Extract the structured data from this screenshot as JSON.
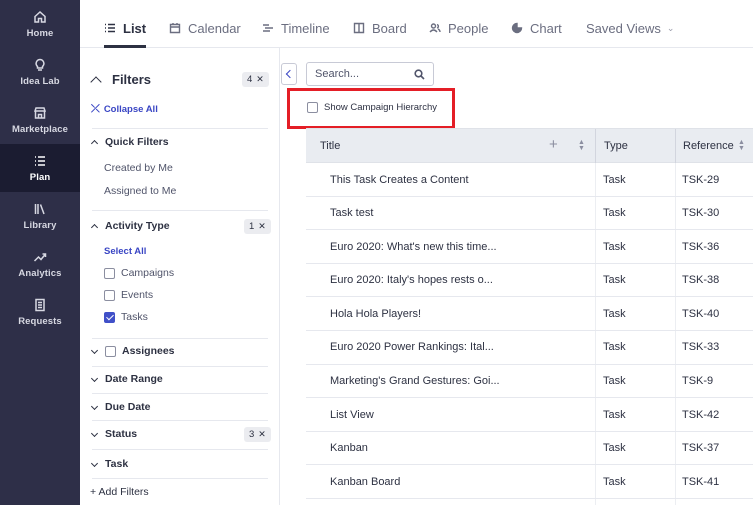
{
  "nav": {
    "items": [
      {
        "label": "Home",
        "icon": "home-icon"
      },
      {
        "label": "Idea Lab",
        "icon": "lightbulb-icon"
      },
      {
        "label": "Marketplace",
        "icon": "store-icon"
      },
      {
        "label": "Plan",
        "icon": "list-icon",
        "active": true
      },
      {
        "label": "Library",
        "icon": "library-icon"
      },
      {
        "label": "Analytics",
        "icon": "trend-icon"
      },
      {
        "label": "Requests",
        "icon": "document-icon"
      }
    ]
  },
  "tabs": {
    "list": "List",
    "calendar": "Calendar",
    "timeline": "Timeline",
    "board": "Board",
    "people": "People",
    "chart": "Chart",
    "saved_views": "Saved Views"
  },
  "filters": {
    "title": "Filters",
    "count": "4",
    "collapse_all": "Collapse All",
    "quick_filters": {
      "label": "Quick Filters",
      "options": [
        "Created by Me",
        "Assigned to Me"
      ]
    },
    "activity_type": {
      "label": "Activity Type",
      "count": "1",
      "select_all": "Select All",
      "options": [
        {
          "label": "Campaigns",
          "checked": false
        },
        {
          "label": "Events",
          "checked": false
        },
        {
          "label": "Tasks",
          "checked": true
        }
      ]
    },
    "assignees": "Assignees",
    "date_range": "Date Range",
    "due_date": "Due Date",
    "status": {
      "label": "Status",
      "count": "3"
    },
    "task": "Task",
    "add_filters": "+ Add Filters"
  },
  "search": {
    "placeholder": "Search..."
  },
  "hierarchy": {
    "label": "Show Campaign Hierarchy",
    "checked": false
  },
  "colors": {
    "nav_bg": "#2e2f48",
    "accent": "#3a46c4",
    "highlight": "#e41e26"
  },
  "table": {
    "columns": [
      "Title",
      "Type",
      "Reference"
    ],
    "rows": [
      {
        "title": "This Task Creates a Content",
        "type": "Task",
        "ref": "TSK-29"
      },
      {
        "title": "Task test",
        "type": "Task",
        "ref": "TSK-30"
      },
      {
        "title": "Euro 2020: What's new this time...",
        "type": "Task",
        "ref": "TSK-36"
      },
      {
        "title": "Euro 2020: Italy's hopes rests o...",
        "type": "Task",
        "ref": "TSK-38"
      },
      {
        "title": "Hola Hola Players!",
        "type": "Task",
        "ref": "TSK-40"
      },
      {
        "title": "Euro 2020 Power Rankings: Ital...",
        "type": "Task",
        "ref": "TSK-33"
      },
      {
        "title": "Marketing's Grand Gestures: Goi...",
        "type": "Task",
        "ref": "TSK-9"
      },
      {
        "title": "List View",
        "type": "Task",
        "ref": "TSK-42"
      },
      {
        "title": "Kanban",
        "type": "Task",
        "ref": "TSK-37"
      },
      {
        "title": "Kanban Board",
        "type": "Task",
        "ref": "TSK-41"
      }
    ]
  }
}
